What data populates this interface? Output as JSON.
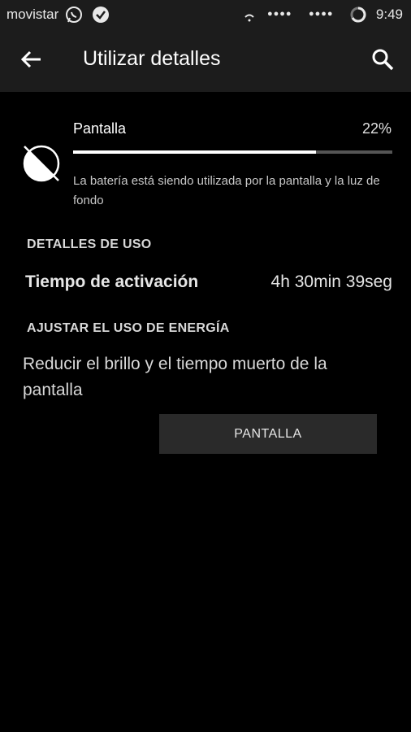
{
  "status_bar": {
    "carrier": "movistar",
    "signal_1": "●●●●",
    "signal_2": "●●●●",
    "time": "9:49"
  },
  "header": {
    "title": "Utilizar detalles",
    "icons": {
      "back": "arrow-left-icon",
      "search": "search-icon"
    }
  },
  "usage": {
    "name": "Pantalla",
    "percent_label": "22%",
    "bar_fill_fraction": 0.76,
    "description": "La batería está siendo utilizada por la pantalla y la luz de fondo",
    "icon": "display-brightness-icon"
  },
  "details": {
    "section_title": "DETALLES DE USO",
    "active_time_label": "Tiempo de activación",
    "active_time_value": "4h 30min 39seg"
  },
  "energy": {
    "section_title": "AJUSTAR EL USO DE ENERGÍA",
    "tip": "Reducir el brillo y el tiempo muerto de la pantalla",
    "button_label": "PANTALLA"
  },
  "colors": {
    "background": "#000000",
    "header_bg": "#1c1c1c",
    "button_bg": "#2a2a2a",
    "bar_fill": "#ffffff",
    "bar_track": "#555555"
  }
}
